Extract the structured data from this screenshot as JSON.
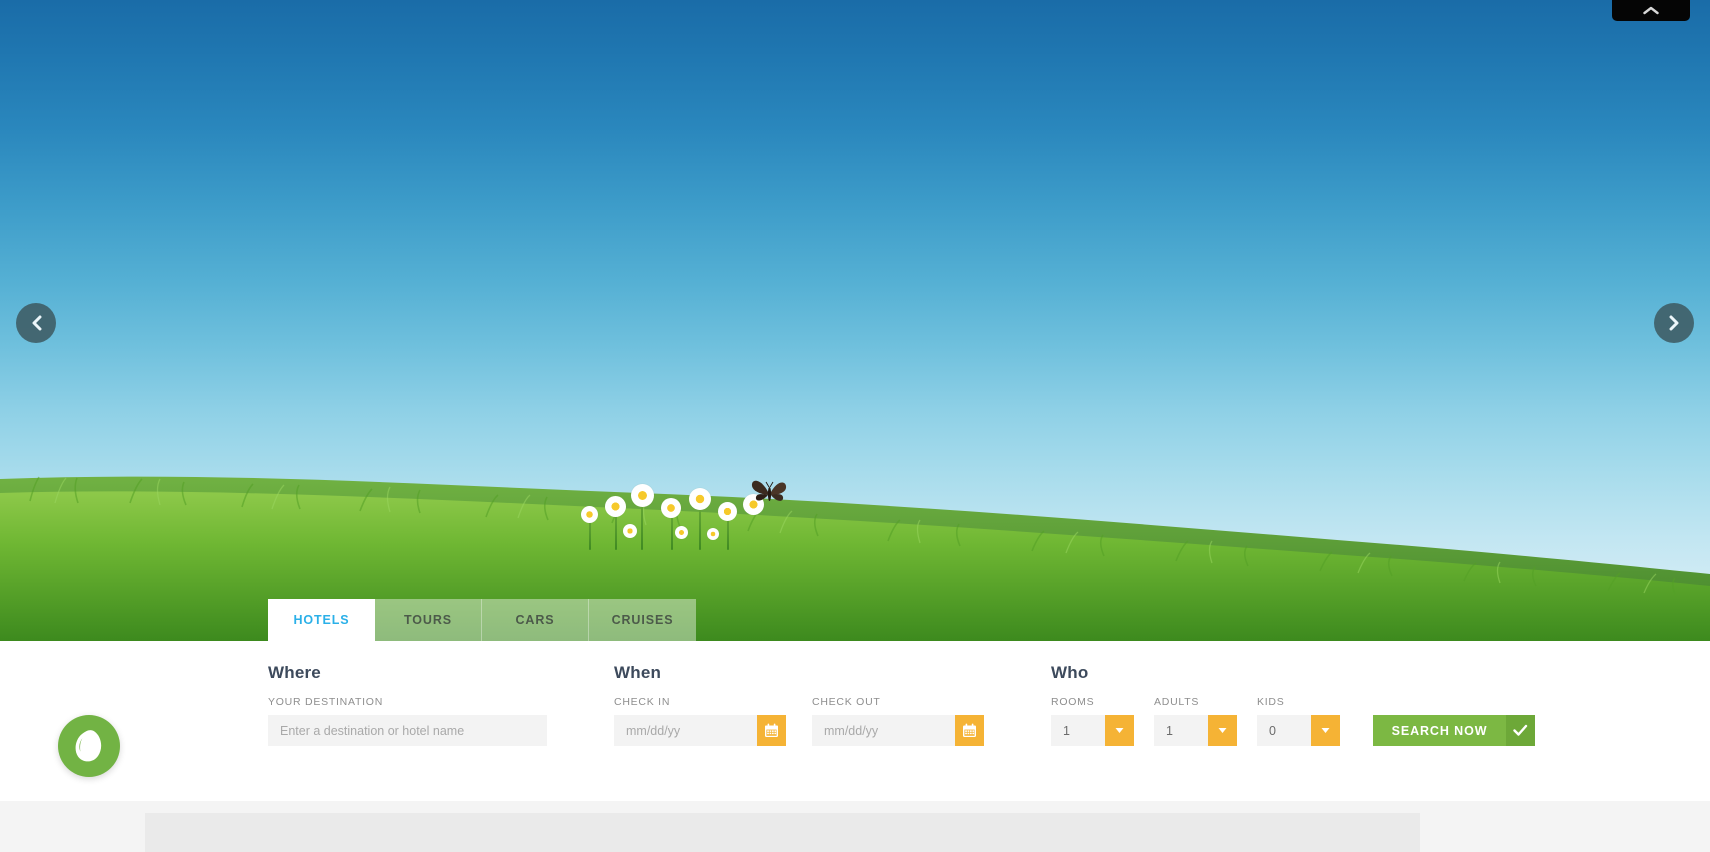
{
  "slider": {
    "prev_label": "Previous slide",
    "next_label": "Next slide",
    "prev_icon": "chevron-left-icon",
    "next_icon": "chevron-right-icon",
    "collapse_icon": "chevron-up-icon",
    "collapse_label": "Collapse panel"
  },
  "brand": {
    "logo_name": "leaf-logo",
    "logo_color": "#72b344"
  },
  "tabs": [
    {
      "label": "HOTELS",
      "active": true
    },
    {
      "label": "TOURS",
      "active": false
    },
    {
      "label": "CARS",
      "active": false
    },
    {
      "label": "CRUISES",
      "active": false
    }
  ],
  "search": {
    "where": {
      "title": "Where",
      "destination_label": "YOUR DESTINATION",
      "destination_placeholder": "Enter a destination or hotel name",
      "destination_value": ""
    },
    "when": {
      "title": "When",
      "checkin_label": "CHECK IN",
      "checkin_placeholder": "mm/dd/yy",
      "checkin_value": "",
      "checkout_label": "CHECK OUT",
      "checkout_placeholder": "mm/dd/yy",
      "checkout_value": "",
      "calendar_icon": "calendar-icon"
    },
    "who": {
      "title": "Who",
      "rooms_label": "ROOMS",
      "rooms_value": "1",
      "adults_label": "ADULTS",
      "adults_value": "1",
      "kids_label": "KIDS",
      "kids_value": "0",
      "dropdown_icon": "caret-down-icon"
    },
    "submit_label": "SEARCH NOW",
    "submit_check_icon": "check-icon"
  },
  "colors": {
    "accent_cyan": "#2bb0e8",
    "accent_orange": "#f5b335",
    "accent_green": "#7cb843",
    "heading": "#3d4a5c"
  }
}
